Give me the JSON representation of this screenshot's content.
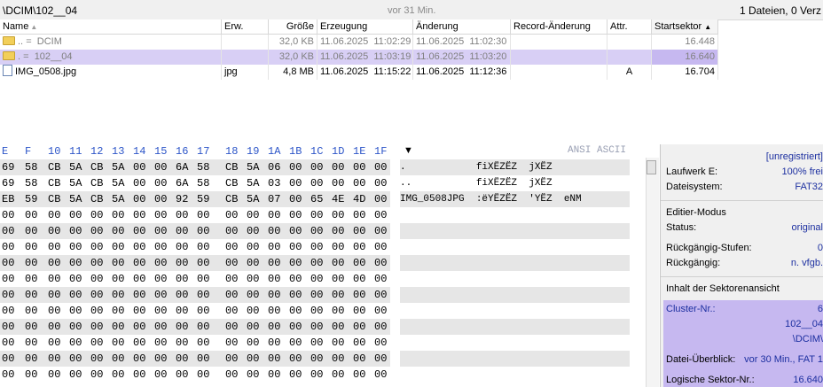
{
  "path": "\\DCIM\\102__04",
  "age": "vor 31 Min.",
  "file_count": "1 Dateien, 0 Verz",
  "columns": [
    "Name",
    "Erw.",
    "Größe",
    "Erzeugung",
    "Änderung",
    "Record-Änderung",
    "Attr.",
    "Startsektor"
  ],
  "files": [
    {
      "prefix": "..",
      "mark": "=",
      "name": "DCIM",
      "ext": "",
      "size": "32,0 KB",
      "created": "11.06.2025  11:02:29",
      "modified": "11.06.2025  11:02:30",
      "record": "",
      "attr": "",
      "sector": "16.448"
    },
    {
      "prefix": ".",
      "mark": "=",
      "name": "102__04",
      "ext": "",
      "size": "32,0 KB",
      "created": "11.06.2025  11:03:19",
      "modified": "11.06.2025  11:03:20",
      "record": "",
      "attr": "",
      "sector": "16.640"
    },
    {
      "prefix": "",
      "mark": "",
      "name": "IMG_0508.jpg",
      "ext": "jpg",
      "size": "4,8 MB",
      "created": "11.06.2025  11:15:22",
      "modified": "11.06.2025  11:12:36",
      "record": "",
      "attr": "A",
      "sector": "16.704"
    }
  ],
  "hex": {
    "header": [
      "E",
      "F",
      "10",
      "11",
      "12",
      "13",
      "14",
      "15",
      "16",
      "17",
      "18",
      "19",
      "1A",
      "1B",
      "1C",
      "1D",
      "1E",
      "1F"
    ],
    "rows": [
      [
        "69",
        "58",
        "CB",
        "5A",
        "CB",
        "5A",
        "00",
        "00",
        "6A",
        "58",
        "CB",
        "5A",
        "06",
        "00",
        "00",
        "00",
        "00",
        "00"
      ],
      [
        "69",
        "58",
        "CB",
        "5A",
        "CB",
        "5A",
        "00",
        "00",
        "6A",
        "58",
        "CB",
        "5A",
        "03",
        "00",
        "00",
        "00",
        "00",
        "00"
      ],
      [
        "EB",
        "59",
        "CB",
        "5A",
        "CB",
        "5A",
        "00",
        "00",
        "92",
        "59",
        "CB",
        "5A",
        "07",
        "00",
        "65",
        "4E",
        "4D",
        "00"
      ],
      [
        "00",
        "00",
        "00",
        "00",
        "00",
        "00",
        "00",
        "00",
        "00",
        "00",
        "00",
        "00",
        "00",
        "00",
        "00",
        "00",
        "00",
        "00"
      ],
      [
        "00",
        "00",
        "00",
        "00",
        "00",
        "00",
        "00",
        "00",
        "00",
        "00",
        "00",
        "00",
        "00",
        "00",
        "00",
        "00",
        "00",
        "00"
      ],
      [
        "00",
        "00",
        "00",
        "00",
        "00",
        "00",
        "00",
        "00",
        "00",
        "00",
        "00",
        "00",
        "00",
        "00",
        "00",
        "00",
        "00",
        "00"
      ],
      [
        "00",
        "00",
        "00",
        "00",
        "00",
        "00",
        "00",
        "00",
        "00",
        "00",
        "00",
        "00",
        "00",
        "00",
        "00",
        "00",
        "00",
        "00"
      ],
      [
        "00",
        "00",
        "00",
        "00",
        "00",
        "00",
        "00",
        "00",
        "00",
        "00",
        "00",
        "00",
        "00",
        "00",
        "00",
        "00",
        "00",
        "00"
      ],
      [
        "00",
        "00",
        "00",
        "00",
        "00",
        "00",
        "00",
        "00",
        "00",
        "00",
        "00",
        "00",
        "00",
        "00",
        "00",
        "00",
        "00",
        "00"
      ],
      [
        "00",
        "00",
        "00",
        "00",
        "00",
        "00",
        "00",
        "00",
        "00",
        "00",
        "00",
        "00",
        "00",
        "00",
        "00",
        "00",
        "00",
        "00"
      ],
      [
        "00",
        "00",
        "00",
        "00",
        "00",
        "00",
        "00",
        "00",
        "00",
        "00",
        "00",
        "00",
        "00",
        "00",
        "00",
        "00",
        "00",
        "00"
      ],
      [
        "00",
        "00",
        "00",
        "00",
        "00",
        "00",
        "00",
        "00",
        "00",
        "00",
        "00",
        "00",
        "00",
        "00",
        "00",
        "00",
        "00",
        "00"
      ],
      [
        "00",
        "00",
        "00",
        "00",
        "00",
        "00",
        "00",
        "00",
        "00",
        "00",
        "00",
        "00",
        "00",
        "00",
        "00",
        "00",
        "00",
        "00"
      ],
      [
        "00",
        "00",
        "00",
        "00",
        "00",
        "00",
        "00",
        "00",
        "00",
        "00",
        "00",
        "00",
        "00",
        "00",
        "00",
        "00",
        "00",
        "00"
      ]
    ],
    "ascii_label": "ANSI ASCII",
    "ascii_rows": [
      ".            fiXËZËZ  jXËZ",
      "..           fiXËZËZ  jXËZ",
      "IMG_0508JPG  :ëYËZËZ  'YËZ  eNM",
      "",
      "",
      "",
      "",
      "",
      "",
      "",
      "",
      "",
      "",
      ""
    ]
  },
  "panel": {
    "unregistered": "[unregistriert]",
    "drive_label": "Laufwerk E:",
    "drive_free": "100% frei",
    "fs_label": "Dateisystem:",
    "fs_value": "FAT32",
    "edit_mode": "Editier-Modus",
    "status_label": "Status:",
    "status_value": "original",
    "undo_levels_label": "Rückgängig-Stufen:",
    "undo_levels_value": "0",
    "undo_label": "Rückgängig:",
    "undo_value": "n. vfgb.",
    "sector_view": "Inhalt der Sektorenansicht",
    "cluster_label": "Cluster-Nr.:",
    "cluster_value": "6",
    "cluster_dir": "102__04",
    "cluster_path": "\\DCIM\\",
    "overview_label": "Datei-Überblick:",
    "overview_value": "vor 30 Min., FAT 1",
    "logical_label": "Logische Sektor-Nr.:",
    "logical_value": "16.640"
  },
  "colors": {
    "selection": "#d8cff5",
    "sorted_selection": "#c6b8f0",
    "hex_header": "#2c55c8"
  }
}
